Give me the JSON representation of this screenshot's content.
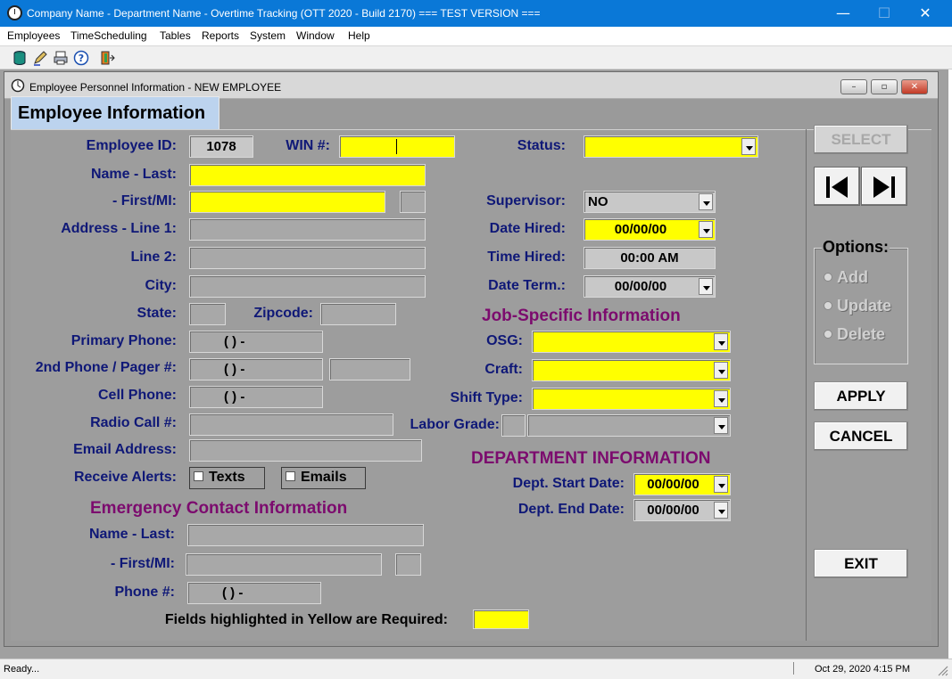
{
  "window": {
    "title": "Company Name - Department Name - Overtime Tracking (OTT 2020 - Build 2170)  === TEST VERSION ===",
    "minimize_glyph": "—",
    "maximize_glyph": "☐",
    "close_glyph": "✕"
  },
  "menu": [
    "Employees",
    "TimeScheduling",
    "Tables",
    "Reports",
    "System",
    "Window",
    "Help"
  ],
  "toolbar_icons": [
    "database-icon",
    "edit-icon",
    "print-icon",
    "help-icon",
    "exit-door-icon"
  ],
  "child_window": {
    "title": "Employee Personnel Information - NEW EMPLOYEE",
    "minimize_glyph": "–",
    "restore_glyph": "▫",
    "close_glyph": "✕"
  },
  "tab_title": "Employee Information",
  "labels": {
    "employee_id": "Employee ID:",
    "win": "WIN #:",
    "status": "Status:",
    "name_last": "Name - Last:",
    "first_mi": "- First/MI:",
    "supervisor": "Supervisor:",
    "address1": "Address - Line 1:",
    "date_hired": "Date Hired:",
    "line2": "Line 2:",
    "time_hired": "Time Hired:",
    "city": "City:",
    "date_term": "Date Term.:",
    "state": "State:",
    "zipcode": "Zipcode:",
    "primary_phone": "Primary Phone:",
    "osg": "OSG:",
    "second_phone": "2nd Phone / Pager #:",
    "craft": "Craft:",
    "cell_phone": "Cell Phone:",
    "shift_type": "Shift Type:",
    "radio_call": "Radio Call #:",
    "labor_grade": "Labor Grade:",
    "email": "Email Address:",
    "receive_alerts": "Receive Alerts:",
    "dept_start": "Dept. Start Date:",
    "dept_end": "Dept. End Date:",
    "ec_name_last": "Name - Last:",
    "ec_first_mi": "- First/MI:",
    "ec_phone": "Phone #:",
    "required_note": "Fields highlighted in Yellow are Required:"
  },
  "sections": {
    "job_specific": "Job-Specific  Information",
    "department": "DEPARTMENT INFORMATION",
    "emergency": "Emergency Contact Information"
  },
  "values": {
    "employee_id": "1078",
    "supervisor": "NO",
    "date_hired": "00/00/00",
    "time_hired": "00:00 AM",
    "date_term": "00/00/00",
    "phone_mask": "(    )    -",
    "dept_start": "00/00/00",
    "dept_end": "00/00/00"
  },
  "alerts": {
    "texts": "Texts",
    "emails": "Emails"
  },
  "buttons": {
    "select": "SELECT",
    "apply": "APPLY",
    "cancel": "CANCEL",
    "exit": "EXIT"
  },
  "options": {
    "title": "Options:",
    "add": "Add",
    "update": "Update",
    "delete": "Delete"
  },
  "status_bar": {
    "message": "Ready...",
    "datetime": "Oct 29, 2020   4:15 PM"
  },
  "colors": {
    "required": "#ffff00",
    "label": "#0f1877",
    "section": "#7c0b6e",
    "titlebar": "#0a78d7"
  }
}
